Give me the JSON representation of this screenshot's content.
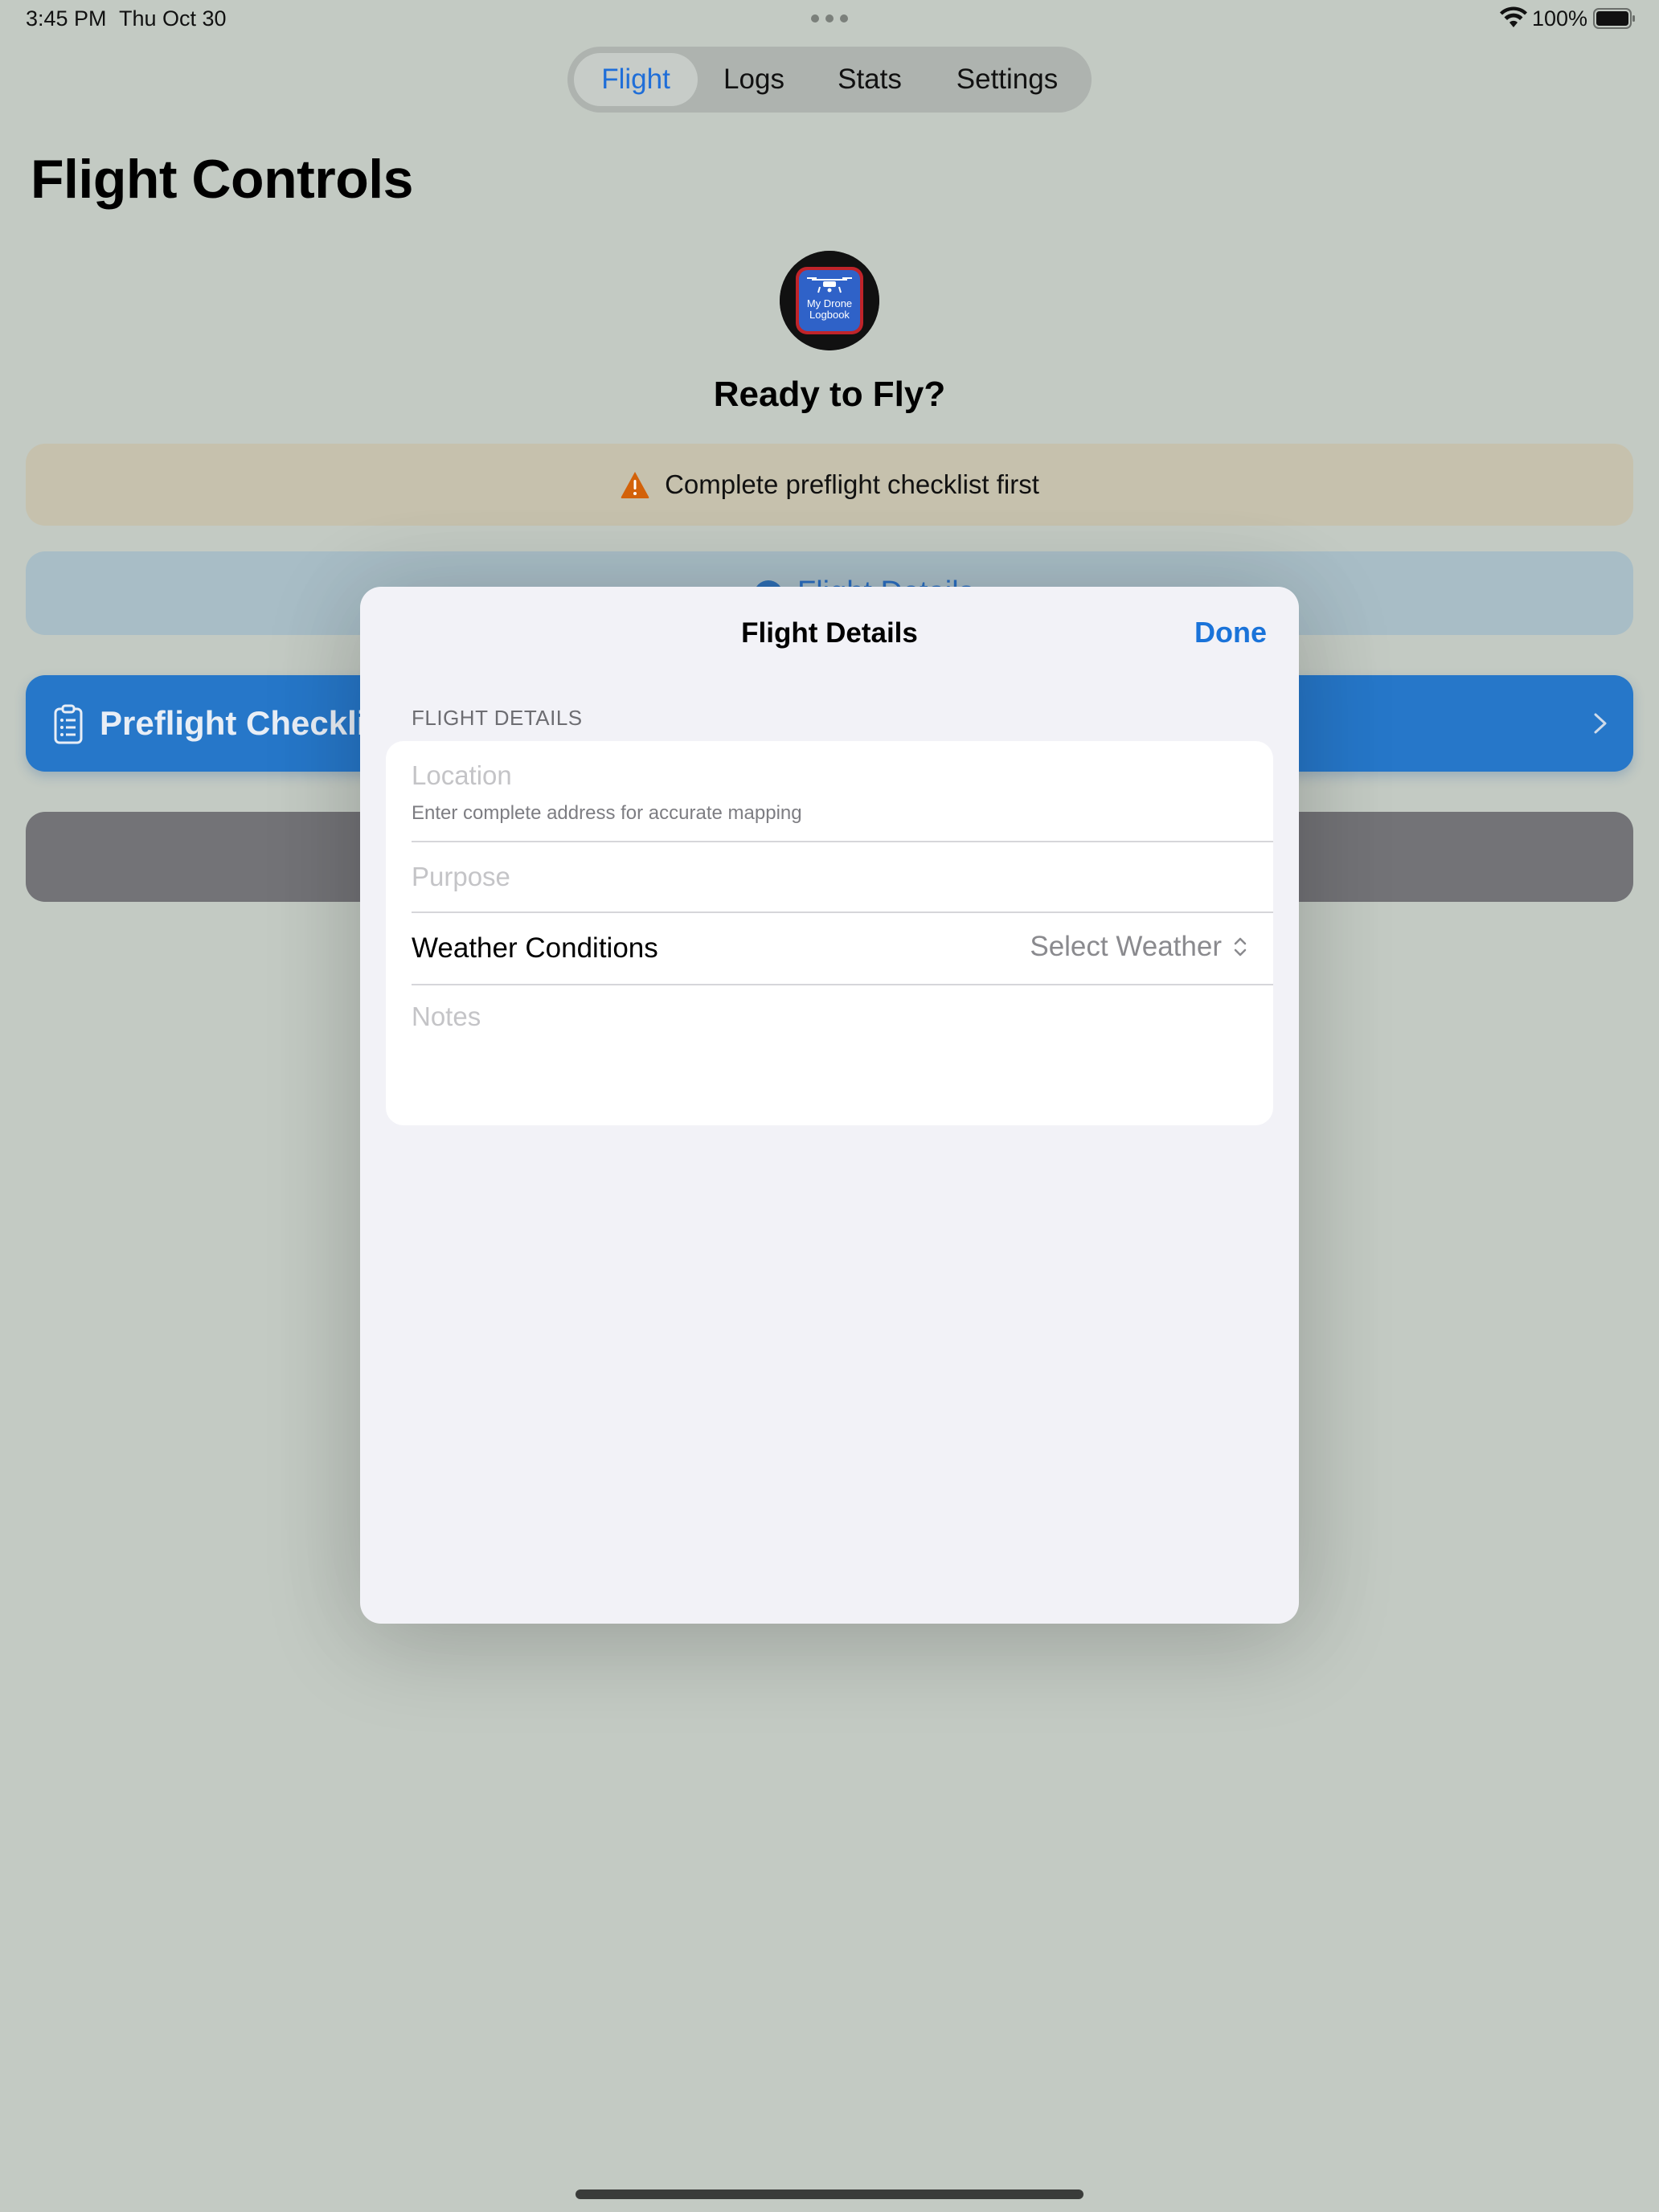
{
  "status_bar": {
    "time": "3:45 PM",
    "date": "Thu Oct 30",
    "battery": "100%"
  },
  "tabs": [
    {
      "label": "Flight",
      "active": true
    },
    {
      "label": "Logs",
      "active": false
    },
    {
      "label": "Stats",
      "active": false
    },
    {
      "label": "Settings",
      "active": false
    }
  ],
  "page": {
    "title": "Flight Controls",
    "logo_text_line1": "My Drone",
    "logo_text_line2": "Logbook",
    "ready_title": "Ready to Fly?",
    "warning": {
      "icon": "warning-triangle-icon",
      "text": "Complete preflight checklist first",
      "color": "#d3620a"
    },
    "details_button": {
      "label": "Flight Details",
      "icon": "info-icon"
    },
    "checklist_button": {
      "label": "Preflight Checklist",
      "icon": "clipboard-icon"
    }
  },
  "sheet": {
    "title": "Flight Details",
    "done_label": "Done",
    "section_header": "FLIGHT DETAILS",
    "location": {
      "placeholder": "Location",
      "value": "",
      "hint": "Enter complete address for accurate mapping"
    },
    "purpose": {
      "placeholder": "Purpose",
      "value": ""
    },
    "weather": {
      "label": "Weather Conditions",
      "selected": "Select Weather"
    },
    "notes": {
      "placeholder": "Notes",
      "value": ""
    }
  },
  "colors": {
    "accent": "#1a73d9",
    "background": "#c3cac3",
    "sheet": "#f2f2f7",
    "checklist_button": "#2677c9"
  }
}
